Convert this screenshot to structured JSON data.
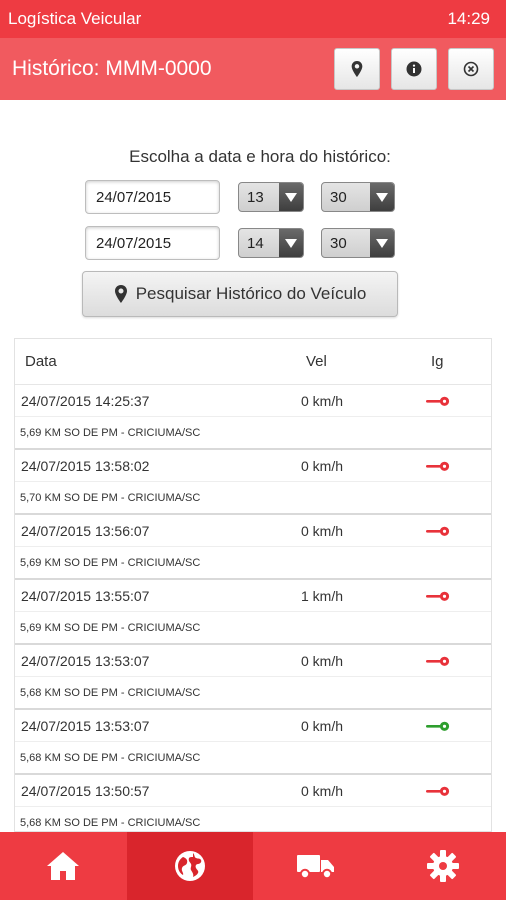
{
  "statusbar": {
    "app_name": "Logística Veicular",
    "time": "14:29"
  },
  "header": {
    "title": "Histórico: MMM-0000",
    "buttons": [
      {
        "icon": "map-marker-icon"
      },
      {
        "icon": "info-icon"
      },
      {
        "icon": "close-circle-icon"
      }
    ]
  },
  "form": {
    "prompt": "Escolha a data e hora do histórico:",
    "start": {
      "date": "24/07/2015",
      "hour": "13",
      "minute": "30"
    },
    "end": {
      "date": "24/07/2015",
      "hour": "14",
      "minute": "30"
    },
    "search_label": "Pesquisar Histórico do Veículo"
  },
  "table": {
    "headers": {
      "date": "Data",
      "speed": "Vel",
      "ignition": "Ig"
    },
    "rows": [
      {
        "datetime": "24/07/2015 14:25:37",
        "speed": "0 km/h",
        "ignition": "off",
        "location": "5,69 KM SO DE PM - CRICIUMA/SC"
      },
      {
        "datetime": "24/07/2015 13:58:02",
        "speed": "0 km/h",
        "ignition": "off",
        "location": "5,70 KM SO DE PM - CRICIUMA/SC"
      },
      {
        "datetime": "24/07/2015 13:56:07",
        "speed": "0 km/h",
        "ignition": "off",
        "location": "5,69 KM SO DE PM - CRICIUMA/SC"
      },
      {
        "datetime": "24/07/2015 13:55:07",
        "speed": "1 km/h",
        "ignition": "off",
        "location": "5,69 KM SO DE PM - CRICIUMA/SC"
      },
      {
        "datetime": "24/07/2015 13:53:07",
        "speed": "0 km/h",
        "ignition": "off",
        "location": "5,68 KM SO DE PM - CRICIUMA/SC"
      },
      {
        "datetime": "24/07/2015 13:53:07",
        "speed": "0 km/h",
        "ignition": "on",
        "location": "5,68 KM SO DE PM - CRICIUMA/SC"
      },
      {
        "datetime": "24/07/2015 13:50:57",
        "speed": "0 km/h",
        "ignition": "off",
        "location": "5,68 KM SO DE PM - CRICIUMA/SC"
      },
      {
        "datetime": "",
        "speed": "",
        "ignition": "off",
        "location": ""
      }
    ]
  },
  "colors": {
    "brand": "#ee3b42",
    "header": "#f15a5f",
    "active_tab": "#d9252c",
    "ignition_off": "#e8323a",
    "ignition_on": "#2e9e2e"
  },
  "bottomnav": [
    {
      "icon": "home-icon",
      "active": false
    },
    {
      "icon": "globe-icon",
      "active": true
    },
    {
      "icon": "truck-icon",
      "active": false
    },
    {
      "icon": "gear-icon",
      "active": false
    }
  ]
}
